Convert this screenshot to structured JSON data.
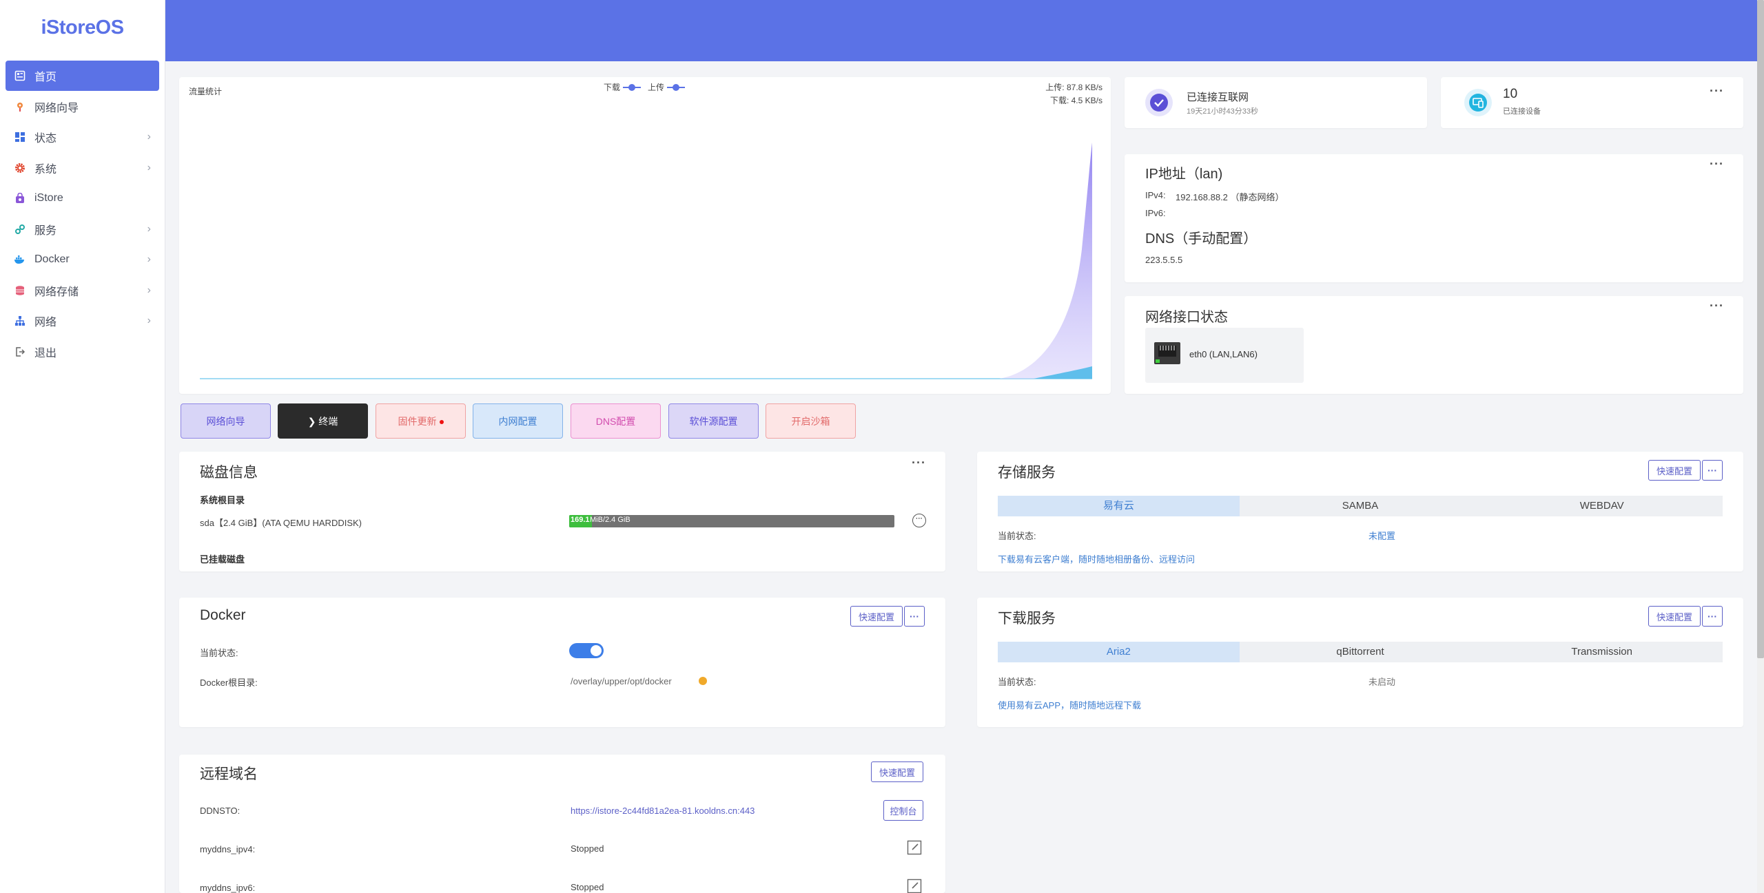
{
  "app": {
    "logo": "iStoreOS"
  },
  "sidebar": {
    "items": [
      {
        "label": "首页",
        "icon": "home-icon",
        "active": true,
        "has_children": false
      },
      {
        "label": "网络向导",
        "icon": "network-wizard-icon",
        "has_children": false
      },
      {
        "label": "状态",
        "icon": "status-icon",
        "has_children": true
      },
      {
        "label": "系统",
        "icon": "gear-icon",
        "has_children": true
      },
      {
        "label": "iStore",
        "icon": "store-icon",
        "has_children": false
      },
      {
        "label": "服务",
        "icon": "services-icon",
        "has_children": true
      },
      {
        "label": "Docker",
        "icon": "docker-icon",
        "has_children": true
      },
      {
        "label": "网络存储",
        "icon": "storage-icon",
        "has_children": true
      },
      {
        "label": "网络",
        "icon": "network-icon",
        "has_children": true
      },
      {
        "label": "退出",
        "icon": "logout-icon",
        "has_children": false
      }
    ]
  },
  "traffic": {
    "title": "流量统计",
    "legend_down": "下载",
    "legend_up": "上传",
    "upload_rate": "上传: 87.8 KB/s",
    "download_rate": "下载: 4.5 KB/s",
    "colors": {
      "download": "#9d8ff0",
      "upload": "#46b7e8"
    }
  },
  "status": {
    "internet": {
      "title": "已连接互联网",
      "uptime": "19天21小时43分33秒"
    },
    "devices": {
      "count": "10",
      "label": "已连接设备"
    },
    "more": "···"
  },
  "ip": {
    "title": "IP地址（lan)",
    "ipv4_label": "IPv4:",
    "ipv4_value": "192.168.88.2 （静态网络）",
    "ipv6_label": "IPv6:",
    "dns_title": "DNS（手动配置）",
    "dns_value": "223.5.5.5"
  },
  "interfaces": {
    "title": "网络接口状态",
    "port_label": "eth0 (LAN,LAN6)"
  },
  "quick": [
    {
      "label": "网络向导",
      "bg": "#d8d5f7",
      "border": "#8f86e6",
      "color": "#5b4fd6"
    },
    {
      "label": "❯ 终端",
      "bg": "#2b2b2b",
      "border": "#2b2b2b",
      "color": "#ffffff"
    },
    {
      "label": "固件更新",
      "bg": "#fde5e5",
      "border": "#f0a2a2",
      "color": "#e26a6a",
      "dot": true
    },
    {
      "label": "内网配置",
      "bg": "#d8e8fa",
      "border": "#82b2ea",
      "color": "#3f7fd1"
    },
    {
      "label": "DNS配置",
      "bg": "#fbd9f0",
      "border": "#ec8fd0",
      "color": "#d24cae"
    },
    {
      "label": "软件源配置",
      "bg": "#dcd7f7",
      "border": "#8f86e6",
      "color": "#5b4fd6"
    },
    {
      "label": "开启沙箱",
      "bg": "#fde5e5",
      "border": "#f0a2a2",
      "color": "#e26a6a"
    }
  ],
  "disk": {
    "title": "磁盘信息",
    "root_label": "系统根目录",
    "disk_name": "sda【2.4 GiB】(ATA QEMU HARDDISK)",
    "usage_text": "169.1 MiB/2.4 GiB",
    "usage_used_label": "169.1",
    "usage_rest_label": "MiB/2.4 GiB",
    "usage_fraction": 0.069,
    "mounted_label": "已挂载磁盘"
  },
  "storage": {
    "title": "存储服务",
    "quick_label": "快速配置",
    "tabs": [
      "易有云",
      "SAMBA",
      "WEBDAV"
    ],
    "status_label": "当前状态:",
    "status_value": "未配置",
    "link": "下载易有云客户端，随时随地相册备份、远程访问"
  },
  "docker": {
    "title": "Docker",
    "quick_label": "快速配置",
    "status_label": "当前状态:",
    "enabled": true,
    "root_label": "Docker根目录:",
    "root_value": "/overlay/upper/opt/docker"
  },
  "download": {
    "title": "下载服务",
    "quick_label": "快速配置",
    "tabs": [
      "Aria2",
      "qBittorrent",
      "Transmission"
    ],
    "status_label": "当前状态:",
    "status_value": "未启动",
    "link": "使用易有云APP，随时随地远程下载"
  },
  "ddns": {
    "title": "远程域名",
    "quick_label": "快速配置",
    "rows": [
      {
        "label": "DDNSTO:",
        "value": "https://istore-2c44fd81a2ea-81.kooldns.cn:443",
        "action": "控制台"
      },
      {
        "label": "myddns_ipv4:",
        "value": "Stopped"
      },
      {
        "label": "myddns_ipv6:",
        "value": "Stopped"
      }
    ]
  }
}
